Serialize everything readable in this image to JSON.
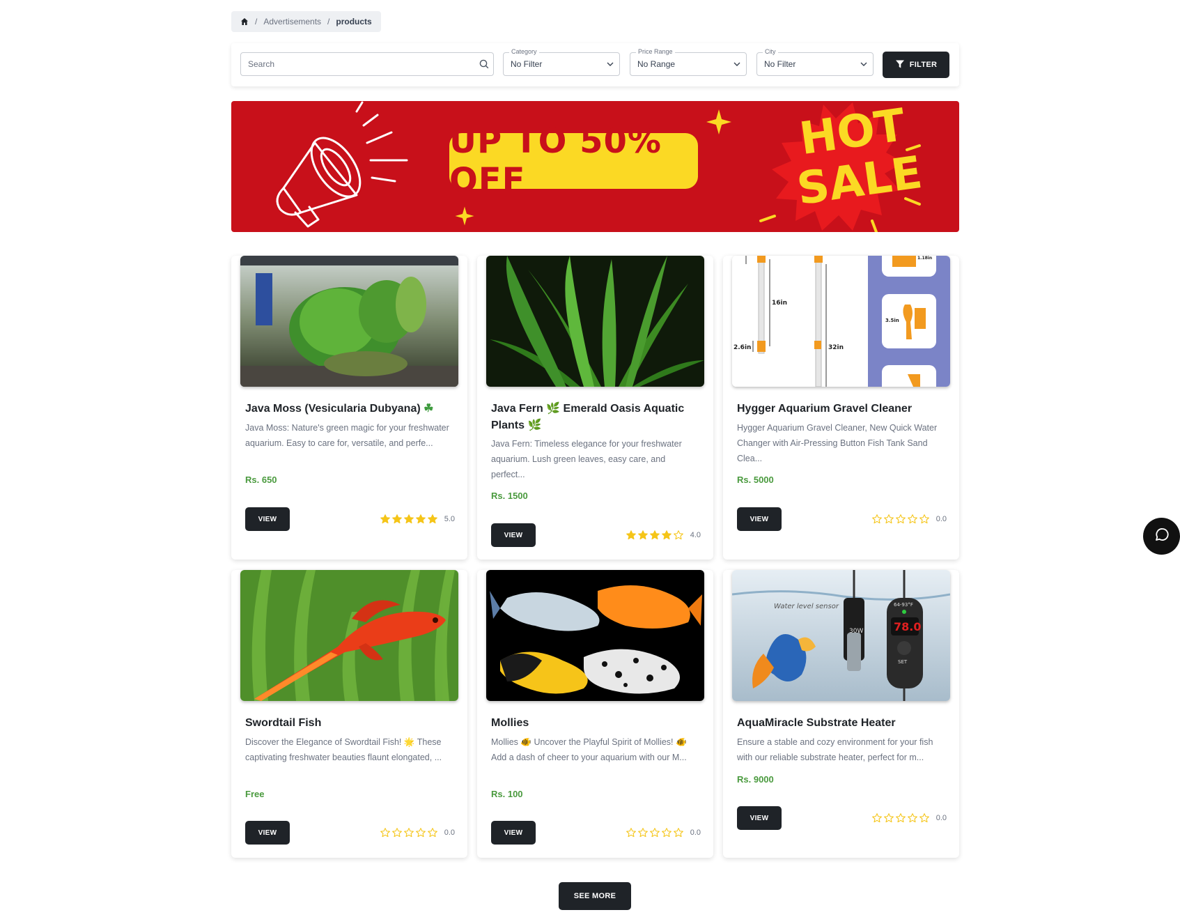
{
  "breadcrumb": {
    "items": [
      "Advertisements",
      "products"
    ],
    "separator": "/"
  },
  "filters": {
    "search_placeholder": "Search",
    "category": {
      "label": "Category",
      "value": "No Filter"
    },
    "price_range": {
      "label": "Price Range",
      "value": "No Range"
    },
    "city": {
      "label": "City",
      "value": "No Filter"
    },
    "filter_button": "FILTER"
  },
  "banner": {
    "offer_text": "UP TO 50% OFF",
    "hot_text": "HOT",
    "sale_text": "SALE"
  },
  "products": [
    {
      "title": "Java Moss (Vesicularia Dubyana)",
      "emoji": "☘",
      "description": "Java Moss: Nature's green magic for your freshwater aquarium. Easy to care for, versatile, and perfe...",
      "price": "Rs. 650",
      "rating": "5.0",
      "stars": 5,
      "button": "VIEW"
    },
    {
      "title": "Java Fern",
      "emoji": "🌿",
      "title_rest": "Emerald Oasis Aquatic Plants",
      "emoji2": "🌿",
      "description": "Java Fern: Timeless elegance for your freshwater aquarium. Lush green leaves, easy care, and perfect...",
      "price": "Rs. 1500",
      "rating": "4.0",
      "stars": 4,
      "button": "VIEW"
    },
    {
      "title": "Hygger Aquarium Gravel Cleaner",
      "description": "Hygger Aquarium Gravel Cleaner, New Quick Water Changer with Air-Pressing Button Fish Tank Sand Clea...",
      "price": "Rs. 5000",
      "rating": "0.0",
      "stars": 0,
      "button": "VIEW",
      "image_labels": [
        "16in",
        "2.6in",
        "32in",
        "3.5in",
        "1.18in"
      ]
    },
    {
      "title": "Swordtail Fish",
      "description_a": "Discover the Elegance of Swordtail Fish!",
      "emoji": "🌟",
      "description_b": "These captivating freshwater beauties flaunt elongated, ...",
      "price": "Free",
      "rating": "0.0",
      "stars": 0,
      "button": "VIEW"
    },
    {
      "title": "Mollies",
      "description_a": "Mollies",
      "emoji": "🐠",
      "description_b": "Uncover the Playful Spirit of Mollies!",
      "emoji2": "🐠",
      "description_c": "Add a dash of cheer to your aquarium with our M...",
      "price": "Rs. 100",
      "rating": "0.0",
      "stars": 0,
      "button": "VIEW"
    },
    {
      "title": "AquaMiracle Substrate Heater",
      "description": "Ensure a stable and cozy environment for your fish with our reliable substrate heater, perfect for m...",
      "price": "Rs. 9000",
      "rating": "0.0",
      "stars": 0,
      "button": "VIEW",
      "image_labels": [
        "Water level sensor",
        "30W",
        "78.0",
        "SET",
        "64-93°F"
      ]
    }
  ],
  "see_more": "SEE MORE",
  "colors": {
    "dark": "#1f2328",
    "price_green": "#4a9a3e",
    "star": "#f5c518",
    "banner_red": "#c8101a",
    "banner_yellow": "#fbd924"
  }
}
